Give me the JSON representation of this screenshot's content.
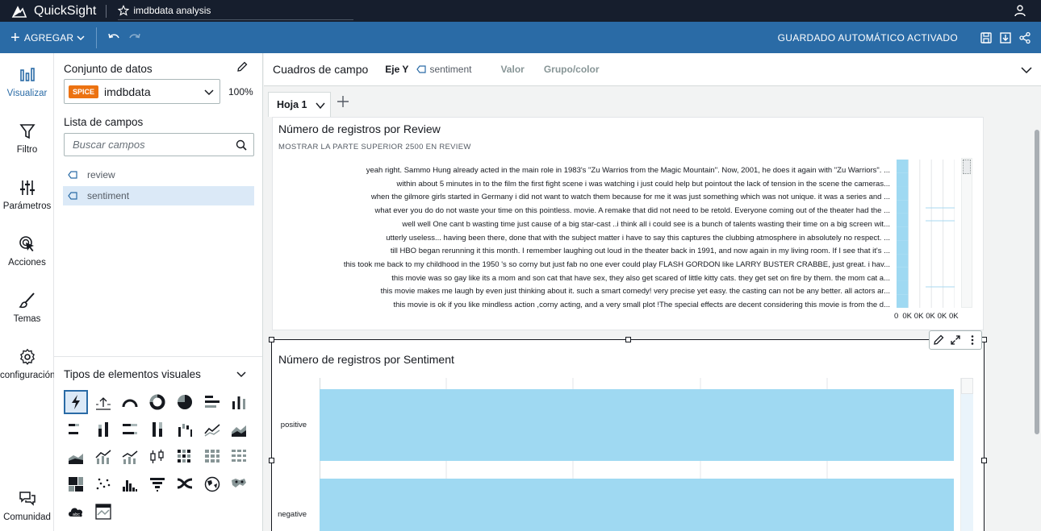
{
  "topbar": {
    "app_name": "QuickSight",
    "analysis_name": "imdbdata analysis"
  },
  "actionbar": {
    "add_label": "AGREGAR",
    "autosave_label": "GUARDADO AUTOMÁTICO ACTIVADO"
  },
  "leftnav": {
    "items": [
      {
        "label": "Visualizar",
        "icon": "bar-chart-icon"
      },
      {
        "label": "Filtro",
        "icon": "filter-icon"
      },
      {
        "label": "Parámetros",
        "icon": "sliders-icon"
      },
      {
        "label": "Acciones",
        "icon": "cursor-click-icon"
      },
      {
        "label": "Temas",
        "icon": "brush-icon"
      },
      {
        "label": "configuración",
        "icon": "gear-icon"
      },
      {
        "label": "Comunidad",
        "icon": "chat-icon"
      }
    ]
  },
  "datapanel": {
    "dataset_title": "Conjunto de datos",
    "spice_badge": "SPICE",
    "dataset_name": "imdbdata",
    "spice_percent": "100%",
    "field_list_title": "Lista de campos",
    "search_placeholder": "Buscar campos",
    "fields": [
      "review",
      "sentiment"
    ],
    "selected_field": "sentiment",
    "visual_types_title": "Tipos de elementos visuales"
  },
  "fieldwells": {
    "title": "Cuadros de campo",
    "y_axis_label": "Eje Y",
    "y_axis_field": "sentiment",
    "value_label": "Valor",
    "group_label": "Grupo/color"
  },
  "sheet": {
    "tab_label": "Hoja 1"
  },
  "visual1": {
    "title": "Número de registros por Review",
    "subtitle": "MOSTRAR LA PARTE SUPERIOR 2500 EN REVIEW",
    "reviews": [
      "yeah right. Sammo Hung already acted in the main role in 1983's \"Zu Warrios from the Magic Mountain\". Now, 2001, he does it again with \"Zu Warriors\". ...",
      "within about 5 minutes in to the film the first fight scene i was watching i just could help but pointout the lack of tension in the scene the cameras...",
      "when the gilmore girls started in Germany i did not want to watch them because for me it was just something which was not unique. it was a series and ...",
      "what ever you do do not waste your time on this pointless. movie. A remake that did not need to be retold. Everyone coming out of the theater had the ...",
      "well well One cant b wasting time just cause of a big star-cast ..i think all i could see is a bunch of talents wasting their time on a big screen wit...",
      "utterly useless... having been there, done that with the subject matter i have to say this captures the clubbing atmosphere in absolutely no respect. ...",
      "till HBO began rerunning it this month. I remember laughing out loud in the theater back in 1991, and now again in my living room. If I see that it's ...",
      "this took me back to my childhood in the 1950 's so corny but just fab no one ever could play FLASH GORDON like LARRY BUSTER CRABBE, just great. i hav...",
      "this movie was so gay like its a mom and son cat that have sex, they also get scared of little kitty cats. they get set on fire by them. the mom cat a...",
      "this movie makes me laugh by even just thinking about it. such a smart comedy! very precise yet easy. the casting can not be any better. all actors ar...",
      "this movie is ok if you like mindless action ,corny acting, and a very small plot !The special effects are decent considering this movie is from the d..."
    ],
    "x_ticks": [
      "0",
      "0K",
      "0K",
      "0K",
      "0K",
      "0K"
    ]
  },
  "visual2": {
    "title": "Número de registros por Sentiment"
  },
  "chart_data": [
    {
      "type": "bar",
      "orientation": "horizontal",
      "title": "Número de registros por Review",
      "subtitle": "MOSTRAR LA PARTE SUPERIOR 2500 EN REVIEW",
      "categories_ref": "visual1.reviews",
      "values": [
        1,
        1,
        1,
        1,
        1,
        1,
        1,
        1,
        1,
        1,
        1
      ],
      "xlim": [
        0,
        5
      ],
      "x_tick_labels": [
        "0",
        "0K",
        "0K",
        "0K",
        "0K",
        "0K"
      ],
      "color": "#9fd9f2"
    },
    {
      "type": "bar",
      "orientation": "horizontal",
      "title": "Número de registros por Sentiment",
      "categories": [
        "positive",
        "negative"
      ],
      "values": [
        25000,
        25000
      ],
      "xlim": [
        0,
        25000
      ],
      "color": "#9fd9f2"
    }
  ]
}
